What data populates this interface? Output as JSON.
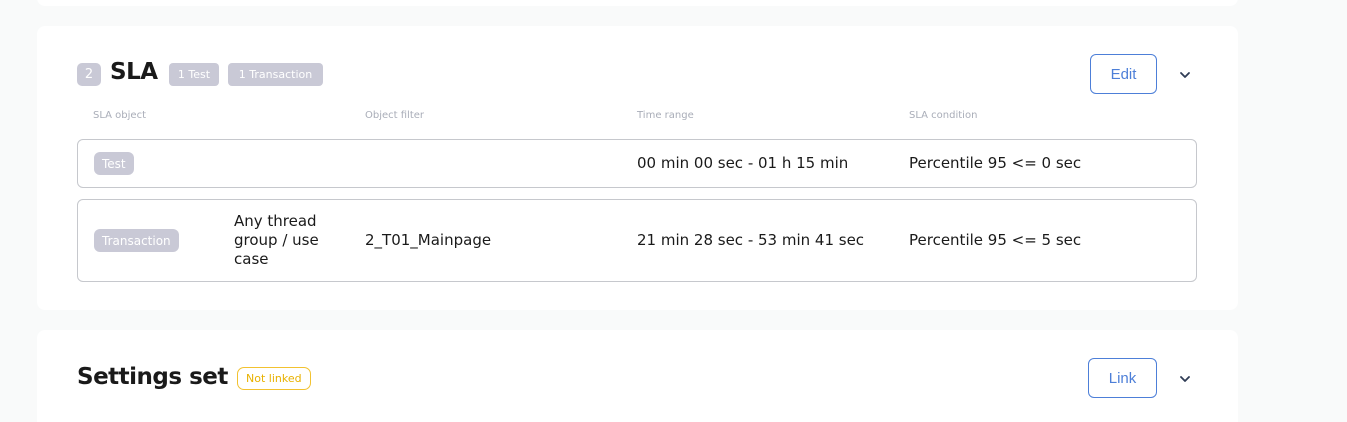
{
  "sla_section": {
    "number": "2",
    "title": "SLA",
    "tags": [
      "1 Test",
      "1 Transaction"
    ],
    "edit_label": "Edit",
    "columns": [
      "SLA object",
      "Object filter",
      "Time range",
      "SLA condition"
    ],
    "rows": [
      {
        "object": "Test",
        "scope": "",
        "filter": "",
        "time_range": "00 min 00 sec - 01 h 15 min",
        "condition": "Percentile 95 <= 0 sec"
      },
      {
        "object": "Transaction",
        "scope": "Any thread group / use case",
        "filter": "2_T01_Mainpage",
        "time_range": "21 min 28 sec - 53 min 41 sec",
        "condition": "Percentile 95 <= 5 sec"
      }
    ]
  },
  "settings_section": {
    "title": "Settings set",
    "status": "Not linked",
    "link_label": "Link"
  },
  "icons": {
    "collapse": "chevron-down-icon"
  },
  "colors": {
    "accent": "#4d7fd8",
    "tag_bg": "#c9c9d6",
    "warning": "#f2c230"
  }
}
